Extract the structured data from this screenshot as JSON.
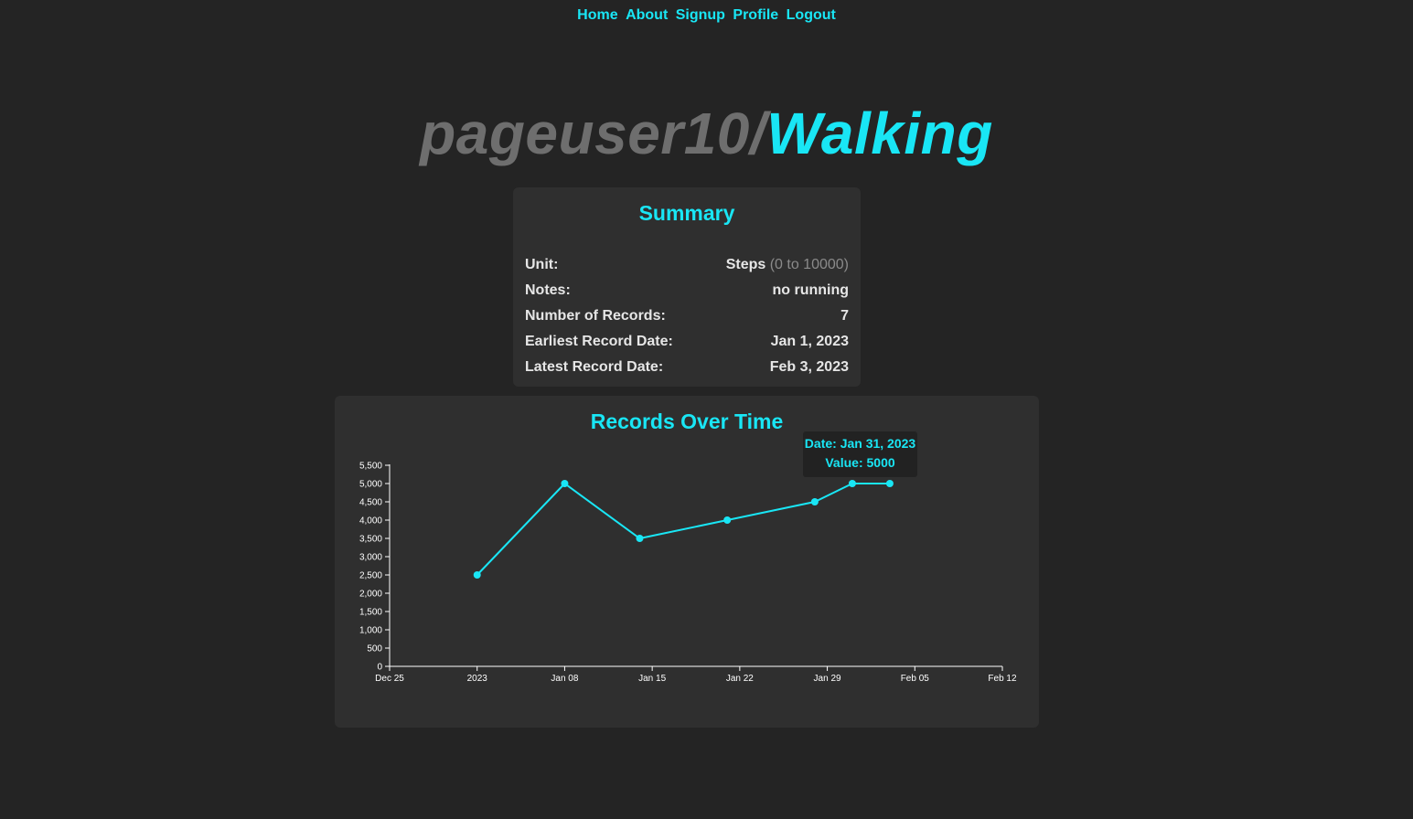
{
  "nav": {
    "items": [
      "Home",
      "About",
      "Signup",
      "Profile",
      "Logout"
    ]
  },
  "title": {
    "user": "pageuser10/",
    "activity": "Walking"
  },
  "summary": {
    "heading": "Summary",
    "unit_label": "Unit:",
    "unit_value": "Steps",
    "unit_range": "(0 to 10000)",
    "notes_label": "Notes:",
    "notes_value": "no running",
    "records_label": "Number of Records:",
    "records_value": "7",
    "earliest_label": "Earliest Record Date:",
    "earliest_value": "Jan 1, 2023",
    "latest_label": "Latest Record Date:",
    "latest_value": "Feb 3, 2023"
  },
  "chart": {
    "heading": "Records Over Time",
    "tooltip_date": "Date: Jan 31, 2023",
    "tooltip_value": "Value: 5000"
  },
  "colors": {
    "accent": "#19e6f5",
    "background": "#242424",
    "card": "#2f2f2f",
    "muted": "#6e6e6e"
  },
  "chart_data": {
    "type": "line",
    "title": "Records Over Time",
    "xlabel": "",
    "ylabel": "",
    "x": [
      "2023-01-01",
      "2023-01-08",
      "2023-01-14",
      "2023-01-21",
      "2023-01-28",
      "2023-01-31",
      "2023-02-03"
    ],
    "values": [
      2500,
      5000,
      3500,
      4000,
      4500,
      5000,
      5000
    ],
    "xlim": [
      "2022-12-25",
      "2023-02-12"
    ],
    "ylim": [
      0,
      5500
    ],
    "x_ticks": [
      {
        "date": "2022-12-25",
        "label": "Dec 25"
      },
      {
        "date": "2023-01-01",
        "label": "2023"
      },
      {
        "date": "2023-01-08",
        "label": "Jan 08"
      },
      {
        "date": "2023-01-15",
        "label": "Jan 15"
      },
      {
        "date": "2023-01-22",
        "label": "Jan 22"
      },
      {
        "date": "2023-01-29",
        "label": "Jan 29"
      },
      {
        "date": "2023-02-05",
        "label": "Feb 05"
      },
      {
        "date": "2023-02-12",
        "label": "Feb 12"
      }
    ],
    "y_ticks": [
      {
        "value": 0,
        "label": "0"
      },
      {
        "value": 500,
        "label": "500"
      },
      {
        "value": 1000,
        "label": "1,000"
      },
      {
        "value": 1500,
        "label": "1,500"
      },
      {
        "value": 2000,
        "label": "2,000"
      },
      {
        "value": 2500,
        "label": "2,500"
      },
      {
        "value": 3000,
        "label": "3,000"
      },
      {
        "value": 3500,
        "label": "3,500"
      },
      {
        "value": 4000,
        "label": "4,000"
      },
      {
        "value": 4500,
        "label": "4,500"
      },
      {
        "value": 5000,
        "label": "5,000"
      },
      {
        "value": 5500,
        "label": "5,500"
      }
    ],
    "grid": false,
    "line_color": "#19e6f5"
  }
}
